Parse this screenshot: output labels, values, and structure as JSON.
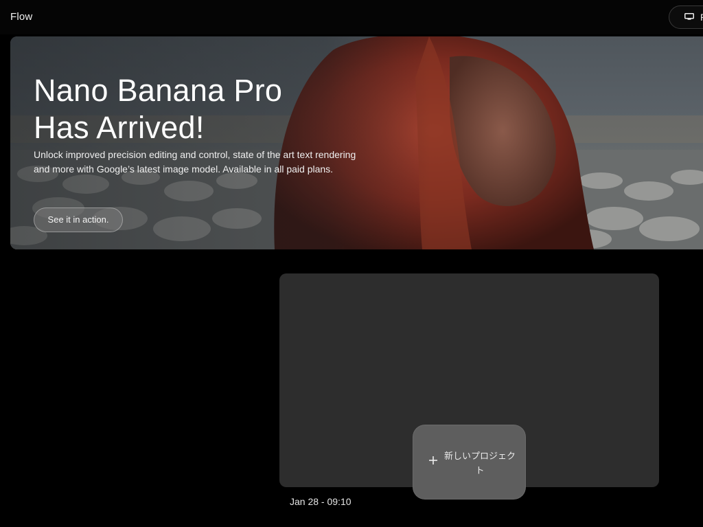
{
  "app": {
    "title": "Flow"
  },
  "header": {
    "right_button_icon": "monitor-icon",
    "right_button_label": "P"
  },
  "hero": {
    "title_line1": "Nano Banana Pro",
    "title_line2": "Has Arrived!",
    "description": "Unlock improved precision editing and control, state of the art text rendering and more with Google’s latest image model. Available in all paid plans.",
    "cta_label": "See it in action."
  },
  "projects": {
    "items": [
      {
        "date": "Jan 28 - 09:10"
      }
    ],
    "new_project_label": "新しいプロジェクト",
    "new_project_icon": "plus-icon"
  },
  "colors": {
    "background": "#000000",
    "card": "#2d2d2d",
    "new_project_button": "#5e5e5e"
  }
}
